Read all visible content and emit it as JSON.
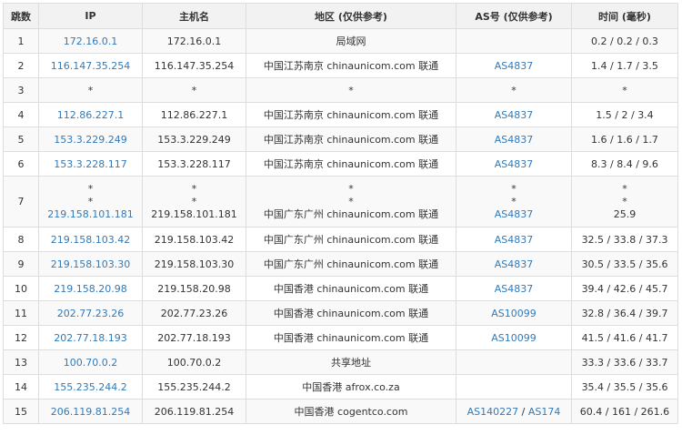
{
  "headers": {
    "hop": "跳数",
    "ip": "IP",
    "host": "主机名",
    "region": "地区 (仅供参考)",
    "asn": "AS号 (仅供参考)",
    "time": "时间 (毫秒)"
  },
  "rows": [
    {
      "hop": "1",
      "ip": "172.16.0.1",
      "host": "172.16.0.1",
      "region": "局域网",
      "as": [],
      "time": "0.2 / 0.2 / 0.3"
    },
    {
      "hop": "2",
      "ip": "116.147.35.254",
      "host": "116.147.35.254",
      "region": "中国江苏南京 chinaunicom.com 联通",
      "as": [
        "AS4837"
      ],
      "time": "1.4 / 1.7 / 3.5"
    },
    {
      "hop": "3",
      "ip": "*",
      "host": "*",
      "region": "*",
      "as_text": "*",
      "time": "*"
    },
    {
      "hop": "4",
      "ip": "112.86.227.1",
      "host": "112.86.227.1",
      "region": "中国江苏南京 chinaunicom.com 联通",
      "as": [
        "AS4837"
      ],
      "time": "1.5 / 2 / 3.4"
    },
    {
      "hop": "5",
      "ip": "153.3.229.249",
      "host": "153.3.229.249",
      "region": "中国江苏南京 chinaunicom.com 联通",
      "as": [
        "AS4837"
      ],
      "time": "1.6 / 1.6 / 1.7"
    },
    {
      "hop": "6",
      "ip": "153.3.228.117",
      "host": "153.3.228.117",
      "region": "中国江苏南京 chinaunicom.com 联通",
      "as": [
        "AS4837"
      ],
      "time": "8.3 / 8.4 / 9.6"
    },
    {
      "hop": "7",
      "multi": true,
      "ip_lines": [
        "*",
        "*",
        "219.158.101.181"
      ],
      "host_lines": [
        "*",
        "*",
        "219.158.101.181"
      ],
      "region_lines": [
        "*",
        "*",
        "中国广东广州 chinaunicom.com 联通"
      ],
      "as_lines": [
        "*",
        "*",
        "AS4837"
      ],
      "time_lines": [
        "*",
        "*",
        "25.9"
      ]
    },
    {
      "hop": "8",
      "ip": "219.158.103.42",
      "host": "219.158.103.42",
      "region": "中国广东广州 chinaunicom.com 联通",
      "as": [
        "AS4837"
      ],
      "time": "32.5 / 33.8 / 37.3"
    },
    {
      "hop": "9",
      "ip": "219.158.103.30",
      "host": "219.158.103.30",
      "region": "中国广东广州 chinaunicom.com 联通",
      "as": [
        "AS4837"
      ],
      "time": "30.5 / 33.5 / 35.6"
    },
    {
      "hop": "10",
      "ip": "219.158.20.98",
      "host": "219.158.20.98",
      "region": "中国香港 chinaunicom.com 联通",
      "as": [
        "AS4837"
      ],
      "time": "39.4 / 42.6 / 45.7"
    },
    {
      "hop": "11",
      "ip": "202.77.23.26",
      "host": "202.77.23.26",
      "region": "中国香港 chinaunicom.com 联通",
      "as": [
        "AS10099"
      ],
      "time": "32.8 / 36.4 / 39.7"
    },
    {
      "hop": "12",
      "ip": "202.77.18.193",
      "host": "202.77.18.193",
      "region": "中国香港 chinaunicom.com 联通",
      "as": [
        "AS10099"
      ],
      "time": "41.5 / 41.6 / 41.7"
    },
    {
      "hop": "13",
      "ip": "100.70.0.2",
      "host": "100.70.0.2",
      "region": "共享地址",
      "as": [],
      "time": "33.3 / 33.6 / 33.7"
    },
    {
      "hop": "14",
      "ip": "155.235.244.2",
      "host": "155.235.244.2",
      "region": "中国香港 afrox.co.za",
      "as": [],
      "time": "35.4 / 35.5 / 35.6"
    },
    {
      "hop": "15",
      "ip": "206.119.81.254",
      "host": "206.119.81.254",
      "region": "中国香港 cogentco.com",
      "as": [
        "AS140227",
        "AS174"
      ],
      "time": "60.4 / 161 / 261.6"
    }
  ],
  "colors": {
    "link": "#337ab7",
    "header_bg": "#f2f2f2",
    "stripe_bg": "#f9f9f9",
    "border": "#dddddd"
  }
}
